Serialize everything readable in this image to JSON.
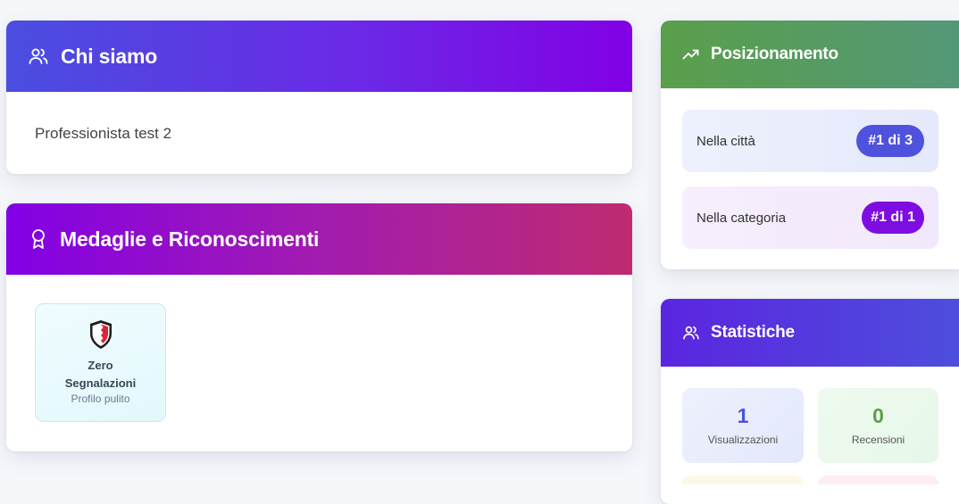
{
  "about": {
    "title": "Chi siamo",
    "icon": "users-icon",
    "text": "Professionista test 2"
  },
  "medals": {
    "title": "Medaglie e Riconoscimenti",
    "icon": "award-icon",
    "items": [
      {
        "icon": "shield-icon",
        "title": "Zero Segnalazioni",
        "subtitle": "Profilo pulito"
      }
    ]
  },
  "ranking": {
    "title": "Posizionamento",
    "icon": "trending-up-icon",
    "city": {
      "label": "Nella città",
      "value": "#1 di 3"
    },
    "category": {
      "label": "Nella categoria",
      "value": "#1 di 1"
    }
  },
  "stats": {
    "title": "Statistiche",
    "icon": "users-icon",
    "views": {
      "value": "1",
      "label": "Visualizzazioni"
    },
    "reviews": {
      "value": "0",
      "label": "Recensioni"
    }
  },
  "colors": {
    "primary": "#4f52dd",
    "purple": "#8200e6",
    "green": "#5a9f4a",
    "magenta": "#be2b70"
  }
}
